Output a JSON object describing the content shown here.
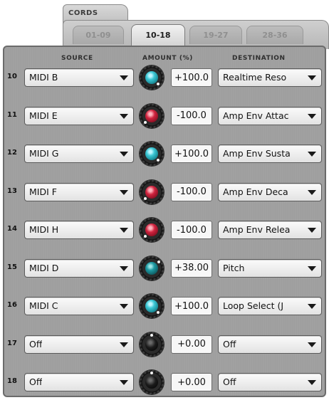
{
  "title": "CORDS",
  "tabs": [
    "01-09",
    "10-18",
    "19-27",
    "28-36"
  ],
  "active_tab": 1,
  "headers": {
    "source": "SOURCE",
    "amount": "AMOUNT (%)",
    "destination": "DESTINATION"
  },
  "colors": {
    "knob_positive": "#2fb3bf",
    "knob_negative": "#c41a35",
    "knob_off": "#101010"
  },
  "rows": [
    {
      "num": "10",
      "source": "MIDI B",
      "amount": "+100.0",
      "destination": "Realtime Reso",
      "knob": "cyan-icon",
      "level": 1.0
    },
    {
      "num": "11",
      "source": "MIDI E",
      "amount": "-100.0",
      "destination": "Amp Env Attac",
      "knob": "red-icon",
      "level": -1.0
    },
    {
      "num": "12",
      "source": "MIDI G",
      "amount": "+100.0",
      "destination": "Amp Env Susta",
      "knob": "cyan-icon",
      "level": 1.0
    },
    {
      "num": "13",
      "source": "MIDI F",
      "amount": "-100.0",
      "destination": "Amp Env Deca",
      "knob": "red-icon",
      "level": -1.0
    },
    {
      "num": "14",
      "source": "MIDI H",
      "amount": "-100.0",
      "destination": "Amp Env Relea",
      "knob": "red-icon",
      "level": -1.0
    },
    {
      "num": "15",
      "source": "MIDI D",
      "amount": "+38.00",
      "destination": "Pitch",
      "knob": "teal-icon",
      "level": 0.38
    },
    {
      "num": "16",
      "source": "MIDI C",
      "amount": "+100.0",
      "destination": "Loop Select (J",
      "knob": "cyan-icon",
      "level": 1.0
    },
    {
      "num": "17",
      "source": "Off",
      "amount": "+0.00",
      "destination": "Off",
      "knob": "black-icon",
      "level": 0.0
    },
    {
      "num": "18",
      "source": "Off",
      "amount": "+0.00",
      "destination": "Off",
      "knob": "black-icon",
      "level": 0.0
    }
  ]
}
